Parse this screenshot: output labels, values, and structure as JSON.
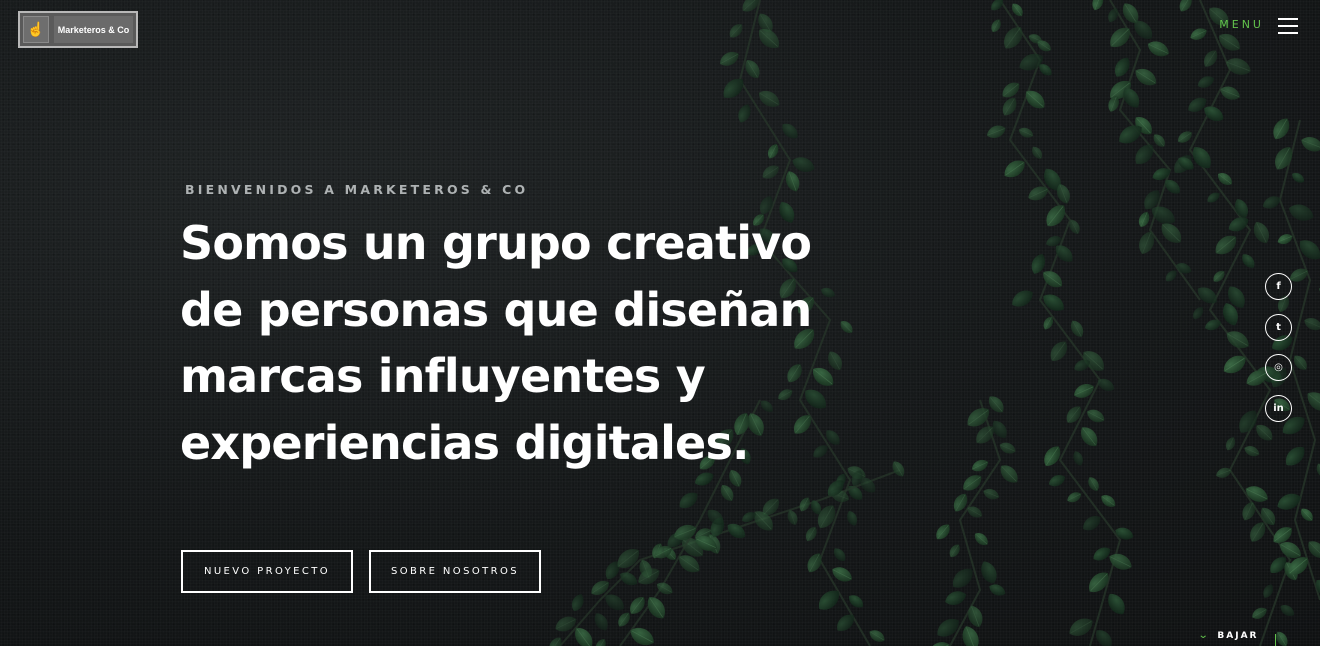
{
  "brand": {
    "logo_text": "Marketeros & Co",
    "logo_icon": "hand-pointer-icon"
  },
  "nav": {
    "menu_label": "MENU",
    "menu_icon": "hamburger-icon",
    "menu_color": "#62c24c"
  },
  "hero": {
    "eyebrow": "BIENVENIDOS A MARKETEROS & CO",
    "headline_lines": [
      "Somos un grupo creativo",
      "de personas que diseñan",
      "marcas influyentes y",
      "experiencias digitales."
    ]
  },
  "buttons": {
    "new_project": "NUEVO PROYECTO",
    "about_us": "SOBRE NOSOTROS"
  },
  "social": [
    {
      "icon": "facebook-icon",
      "glyph": "f"
    },
    {
      "icon": "twitter-icon",
      "glyph": "t"
    },
    {
      "icon": "instagram-icon",
      "glyph": "◎"
    },
    {
      "icon": "linkedin-icon",
      "glyph": "in"
    }
  ],
  "scroll": {
    "label": "BAJAR",
    "icon": "chevron-down-icon",
    "glyph": "⌄"
  },
  "colors": {
    "accent": "#62c24c",
    "background": "#16191a",
    "text": "#ffffff"
  }
}
